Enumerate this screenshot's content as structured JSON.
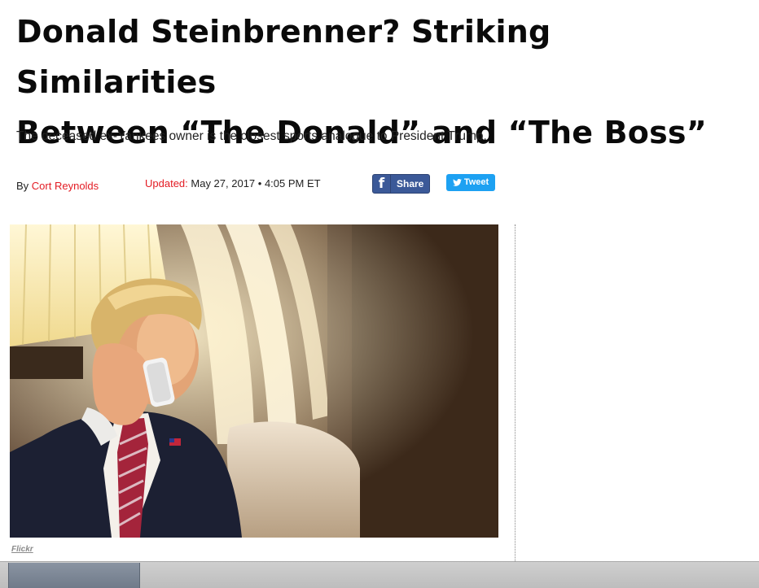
{
  "article": {
    "headline_line1": "Donald Steinbrenner? Striking Similarities",
    "headline_line2": "Between “The Donald” and “The Boss”",
    "dek": "The deceased ex-Yankees owner is the closest sports analogue to President Trump.",
    "byline_prefix": "By",
    "author": "Cort Reynolds",
    "updated_label": "Updated:",
    "updated_value": "May 27, 2017 • 4:05 PM ET"
  },
  "share": {
    "facebook_label": "Share",
    "twitter_label": "Tweet",
    "facebook_icon": "facebook-f-icon",
    "twitter_icon": "twitter-bird-icon",
    "facebook_color": "#3b5998",
    "twitter_color": "#1da1f2"
  },
  "photo": {
    "credit": "Flickr"
  },
  "colors": {
    "accent": "#e31b23",
    "headline": "#0a0a0a"
  }
}
